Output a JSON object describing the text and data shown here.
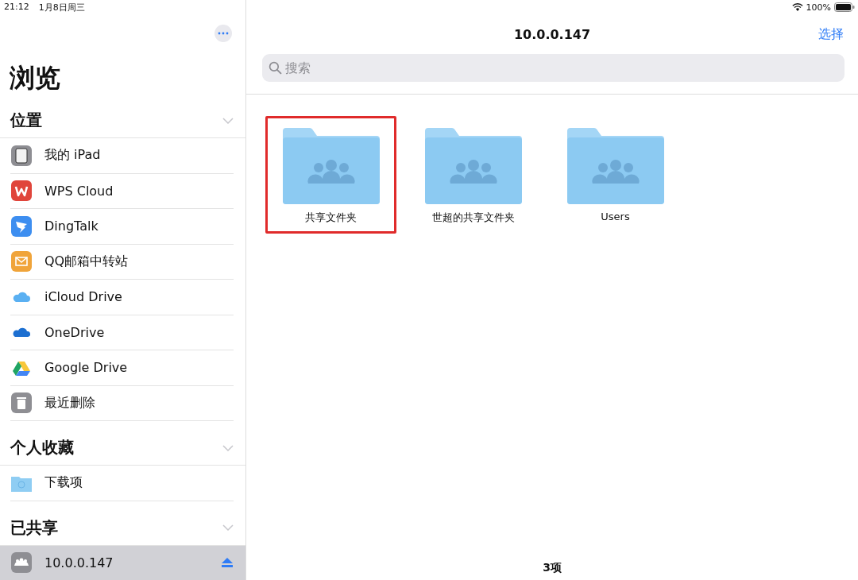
{
  "status_bar": {
    "time": "21:12",
    "date": "1月8日周三",
    "battery": "100%"
  },
  "sidebar": {
    "title": "浏览",
    "sections": [
      {
        "title": "位置",
        "expanded": true,
        "items": [
          {
            "kind": "ipad",
            "label": "我的 iPad",
            "selected": false
          },
          {
            "kind": "wps",
            "label": "WPS Cloud",
            "selected": false
          },
          {
            "kind": "dingtalk",
            "label": "DingTalk",
            "selected": false
          },
          {
            "kind": "mail",
            "label": "QQ邮箱中转站",
            "selected": false
          },
          {
            "kind": "icloud",
            "label": "iCloud Drive",
            "selected": false
          },
          {
            "kind": "onedrive",
            "label": "OneDrive",
            "selected": false
          },
          {
            "kind": "gdrive",
            "label": "Google Drive",
            "selected": false
          },
          {
            "kind": "trash",
            "label": "最近删除",
            "selected": false
          }
        ]
      },
      {
        "title": "个人收藏",
        "expanded": true,
        "items": [
          {
            "kind": "downloads",
            "label": "下载项",
            "selected": false
          }
        ]
      },
      {
        "title": "已共享",
        "expanded": true,
        "items": [
          {
            "kind": "server",
            "label": "10.0.0.147",
            "selected": true,
            "eject": true
          }
        ]
      }
    ]
  },
  "main": {
    "title": "10.0.0.147",
    "select_button": "选择",
    "search": {
      "placeholder": "搜索"
    },
    "folders": [
      {
        "name": "共享文件夹",
        "highlighted": true
      },
      {
        "name": "世超的共享文件夹",
        "highlighted": false
      },
      {
        "name": "Users",
        "highlighted": false
      }
    ],
    "footer": "3项"
  }
}
